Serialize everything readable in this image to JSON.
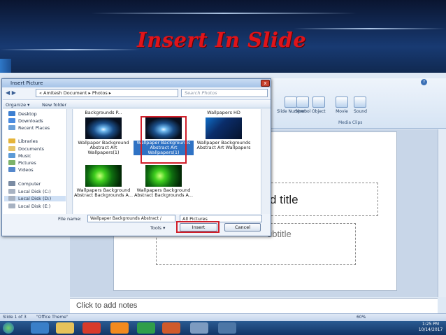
{
  "slide_heading": "Insert In Slide",
  "dialog": {
    "title": "Insert Picture",
    "close": "x",
    "address": "« Amitesh Document ▸ Photos ▸",
    "search_placeholder": "Search Photos",
    "toolbar": {
      "organize": "Organize ▾",
      "new_folder": "New folder"
    },
    "sidebar": [
      {
        "label": "Desktop",
        "color": "#3d7fd1"
      },
      {
        "label": "Downloads",
        "color": "#4a8be0"
      },
      {
        "label": "Recent Places",
        "color": "#6a9fd8"
      },
      {
        "label": "Libraries",
        "color": "#e5b43a"
      },
      {
        "label": "Documents",
        "color": "#e5c46a"
      },
      {
        "label": "Music",
        "color": "#5c9ad6"
      },
      {
        "label": "Pictures",
        "color": "#7db36a"
      },
      {
        "label": "Videos",
        "color": "#5588cc"
      },
      {
        "label": "Computer",
        "color": "#7a8ba3"
      },
      {
        "label": "Local Disk (C:)",
        "color": "#a7b2c2"
      },
      {
        "label": "Local Disk (D:)",
        "color": "#a7b2c2"
      },
      {
        "label": "Local Disk (E:)",
        "color": "#a7b2c2"
      }
    ],
    "top_captions": [
      "Backgrounds P...",
      "Wallpapers HD"
    ],
    "tiles": [
      {
        "caption": "Wallpaper Background Abstract Art Wallpapers(1)"
      },
      {
        "caption": "Wallpaper Backgrounds Abstract Art Wallpapers(1)"
      },
      {
        "caption": "Wallpaper Backgrounds Abstract Art Wallpapers"
      },
      {
        "caption": "Wallpapers Background Abstract Backgrounds A..."
      },
      {
        "caption": "Wallpapers Background Abstract Backgrounds A..."
      }
    ],
    "file_name_label": "File name:",
    "file_name_value": "Wallpaper Backgrounds Abstract /",
    "file_type": "All Pictures",
    "tools_label": "Tools ▾",
    "insert": "Insert",
    "cancel": "Cancel"
  },
  "ribbon": {
    "buttons": [
      "Slide Number",
      "Symbol",
      "Object",
      "Movie",
      "Sound"
    ],
    "group_label": "Media Clips"
  },
  "slide": {
    "title_placeholder": "d title",
    "subtitle_placeholder": "ubtitle"
  },
  "notes": "Click to add notes",
  "status": {
    "slide": "Slide 1 of 3",
    "theme": "\"Office Theme\"",
    "zoom": "60%"
  },
  "clock": {
    "time": "1:25 PM",
    "date": "10/14/2017"
  }
}
